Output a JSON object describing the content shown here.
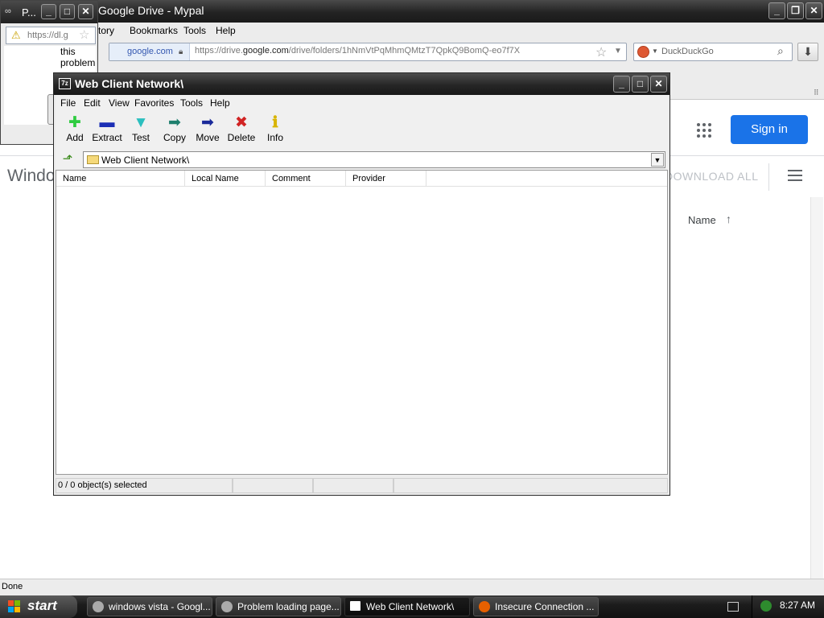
{
  "browser": {
    "title": "Google Drive - Mypal",
    "menu": [
      "tory",
      "Bookmarks",
      "Tools",
      "Help"
    ],
    "site_identity": "google.com",
    "url_prefix": "https://drive.",
    "url_domain": "google.com",
    "url_path": "/drive/folders/1hNmVtPqMhmQMtzT7QpkQ9BomQ-eo7f7X",
    "search_placeholder": "DuckDuckGo",
    "status": "Done"
  },
  "drive_page": {
    "sign_in": "Sign in",
    "heading_partial": "Windo",
    "download_all": "DOWNLOAD ALL",
    "sort_label": "Name",
    "sort_arrow": "↑"
  },
  "popup": {
    "title": "P...",
    "url": "https://dl.g",
    "line1": "this",
    "line2": "problem"
  },
  "sevenzip": {
    "title": "Web Client Network\\",
    "logo": "7z",
    "menu": [
      "File",
      "Edit",
      "View",
      "Favorites",
      "Tools",
      "Help"
    ],
    "toolbar": [
      {
        "label": "Add",
        "icon": "add-icon",
        "glyph": "✚",
        "color": "#2ecc40"
      },
      {
        "label": "Extract",
        "icon": "extract-icon",
        "glyph": "▬",
        "color": "#1c2fb5"
      },
      {
        "label": "Test",
        "icon": "test-icon",
        "glyph": "▼",
        "color": "#2bbfbf"
      },
      {
        "label": "Copy",
        "icon": "copy-icon",
        "glyph": "➡",
        "color": "#1e7f6e"
      },
      {
        "label": "Move",
        "icon": "move-icon",
        "glyph": "➡",
        "color": "#1a2a9a"
      },
      {
        "label": "Delete",
        "icon": "delete-icon",
        "glyph": "✖",
        "color": "#d12424"
      },
      {
        "label": "Info",
        "icon": "info-icon",
        "glyph": "ℹ",
        "color": "#d8b400"
      }
    ],
    "address": "Web Client Network\\",
    "columns": [
      "Name",
      "Local Name",
      "Comment",
      "Provider"
    ],
    "status": "0 / 0 object(s) selected"
  },
  "taskbar": {
    "start": "start",
    "tasks": [
      {
        "label": "windows vista - Googl...",
        "active": false
      },
      {
        "label": "Problem loading page...",
        "active": false
      },
      {
        "label": "Web Client Network\\",
        "active": true
      },
      {
        "label": "Insecure Connection ...",
        "active": false
      }
    ],
    "clock": "8:27 AM"
  },
  "colors": {
    "signin_blue": "#1a73e8",
    "titlebar_dark": "#232323"
  }
}
